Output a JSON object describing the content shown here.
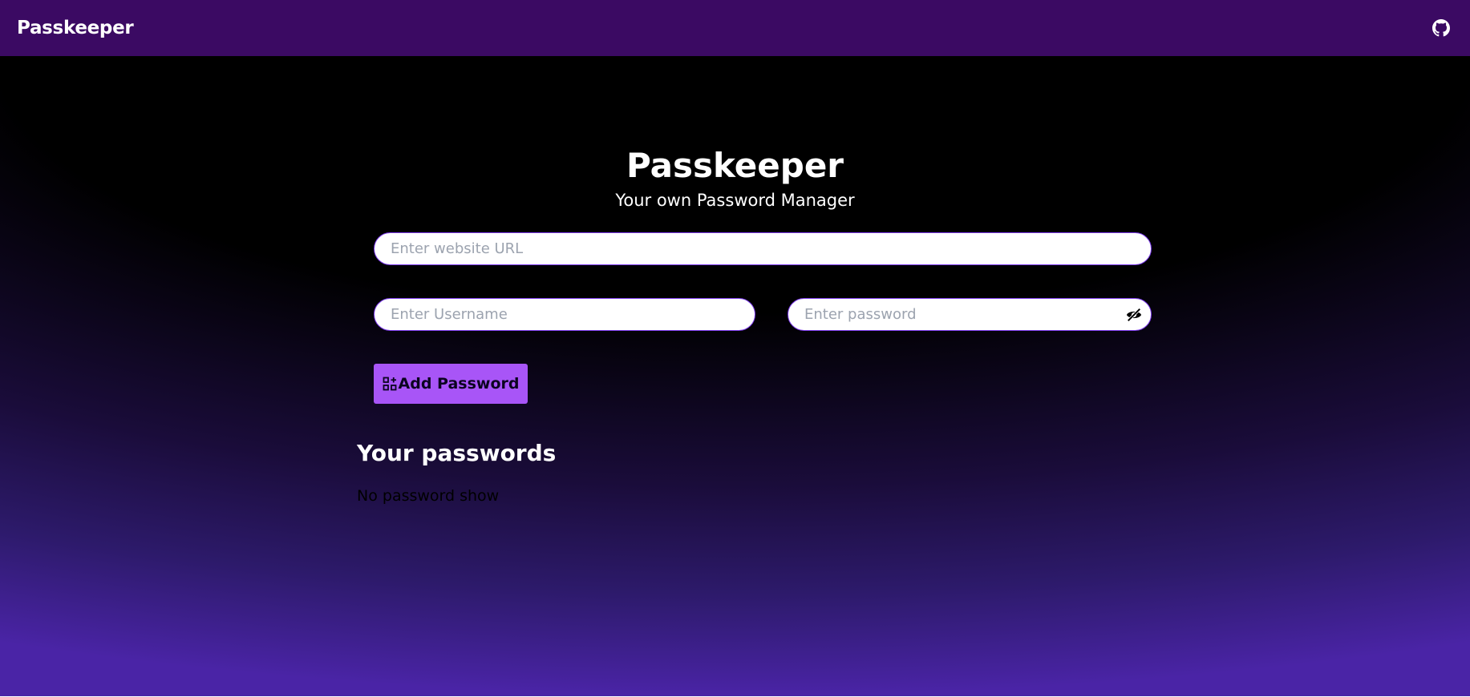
{
  "navbar": {
    "brand": "Passkeeper",
    "github_icon": "github-icon"
  },
  "hero": {
    "title": "Passkeeper",
    "subtitle": "Your own Password Manager"
  },
  "form": {
    "url_placeholder": "Enter website URL",
    "username_placeholder": "Enter Username",
    "password_placeholder": "Enter password",
    "password_toggle_icon": "eye-slash-icon",
    "add_button_label": "Add Password",
    "add_button_icon": "add-grid-icon"
  },
  "passwords": {
    "heading": "Your passwords",
    "empty_message": "No password show"
  },
  "colors": {
    "navbar_bg": "#3b0a63",
    "accent": "#a855f7",
    "input_border": "#7c3aed"
  }
}
